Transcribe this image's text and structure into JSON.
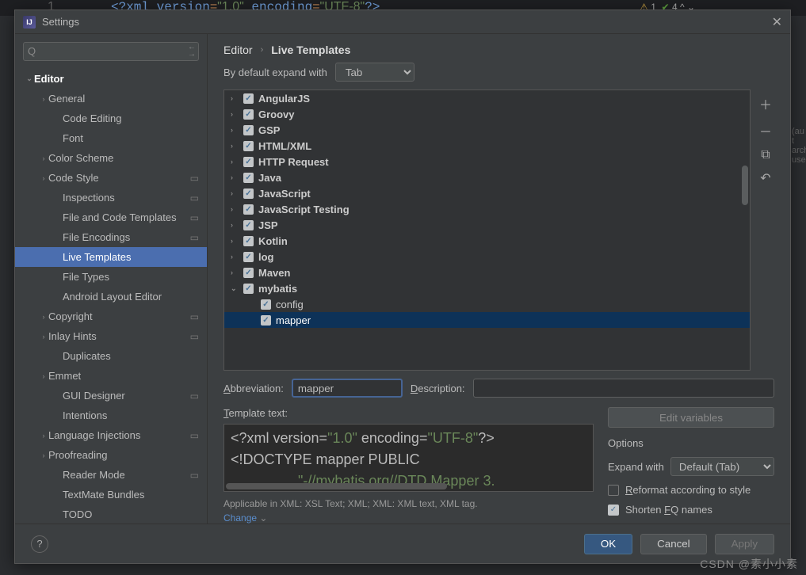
{
  "bg": {
    "code": "<?xml version=\"1.0\" encoding=\"UTF-8\"?>",
    "linenum": "1",
    "warn_yellow": "1",
    "warn_green": "4"
  },
  "dialog": {
    "title": "Settings"
  },
  "breadcrumb": {
    "a": "Editor",
    "b": "Live Templates"
  },
  "expand": {
    "label": "By default expand with",
    "value": "Tab"
  },
  "sidebar_search_placeholder": "",
  "sidebar": [
    {
      "label": "Editor",
      "level": 0,
      "chev": "⌄",
      "bold": true
    },
    {
      "label": "General",
      "level": 1,
      "chev": "›"
    },
    {
      "label": "Code Editing",
      "level": 2
    },
    {
      "label": "Font",
      "level": 2
    },
    {
      "label": "Color Scheme",
      "level": 1,
      "chev": "›"
    },
    {
      "label": "Code Style",
      "level": 1,
      "chev": "›",
      "gear": true
    },
    {
      "label": "Inspections",
      "level": 2,
      "gear": true
    },
    {
      "label": "File and Code Templates",
      "level": 2,
      "gear": true
    },
    {
      "label": "File Encodings",
      "level": 2,
      "gear": true
    },
    {
      "label": "Live Templates",
      "level": 2,
      "selected": true
    },
    {
      "label": "File Types",
      "level": 2
    },
    {
      "label": "Android Layout Editor",
      "level": 2
    },
    {
      "label": "Copyright",
      "level": 1,
      "chev": "›",
      "gear": true
    },
    {
      "label": "Inlay Hints",
      "level": 1,
      "chev": "›",
      "gear": true
    },
    {
      "label": "Duplicates",
      "level": 2
    },
    {
      "label": "Emmet",
      "level": 1,
      "chev": "›"
    },
    {
      "label": "GUI Designer",
      "level": 2,
      "gear": true
    },
    {
      "label": "Intentions",
      "level": 2
    },
    {
      "label": "Language Injections",
      "level": 1,
      "chev": "›",
      "gear": true
    },
    {
      "label": "Proofreading",
      "level": 1,
      "chev": "›"
    },
    {
      "label": "Reader Mode",
      "level": 2,
      "gear": true
    },
    {
      "label": "TextMate Bundles",
      "level": 2
    },
    {
      "label": "TODO",
      "level": 2
    }
  ],
  "templates": [
    {
      "label": "AngularJS",
      "chev": "›",
      "bold": true
    },
    {
      "label": "Groovy",
      "chev": "›",
      "bold": true
    },
    {
      "label": "GSP",
      "chev": "›",
      "bold": true
    },
    {
      "label": "HTML/XML",
      "chev": "›",
      "bold": true
    },
    {
      "label": "HTTP Request",
      "chev": "›",
      "bold": true
    },
    {
      "label": "Java",
      "chev": "›",
      "bold": true
    },
    {
      "label": "JavaScript",
      "chev": "›",
      "bold": true
    },
    {
      "label": "JavaScript Testing",
      "chev": "›",
      "bold": true
    },
    {
      "label": "JSP",
      "chev": "›",
      "bold": true
    },
    {
      "label": "Kotlin",
      "chev": "›",
      "bold": true
    },
    {
      "label": "log",
      "chev": "›",
      "bold": true
    },
    {
      "label": "Maven",
      "chev": "›",
      "bold": true
    },
    {
      "label": "mybatis",
      "chev": "⌄",
      "bold": true
    },
    {
      "label": "config",
      "child": true
    },
    {
      "label": "mapper",
      "child": true,
      "selected": true
    }
  ],
  "form": {
    "abbr_label": "Abbreviation:",
    "abbr_value": "mapper",
    "desc_label": "Description:",
    "desc_value": "",
    "tt_label": "Template text:",
    "l1_a": "<?xml version=",
    "l1_b": "\"1.0\"",
    "l1_c": " encoding=",
    "l1_d": "\"UTF-8\"",
    "l1_e": "?>",
    "l2": "<!DOCTYPE mapper PUBLIC",
    "l3_a": "\"-//mybatis.org//DTD Mapper 3.",
    "applicable": "Applicable in XML: XSL Text; XML; XML: XML text, XML tag.",
    "change": "Change"
  },
  "right": {
    "edit_vars": "Edit variables",
    "options": "Options",
    "expand_label": "Expand with",
    "expand_value": "Default (Tab)",
    "reformat": "Reformat according to style",
    "shorten": "Shorten FQ names"
  },
  "buttons": {
    "ok": "OK",
    "cancel": "Cancel",
    "apply": "Apply",
    "help": "?"
  },
  "watermark": "CSDN @素小小素"
}
